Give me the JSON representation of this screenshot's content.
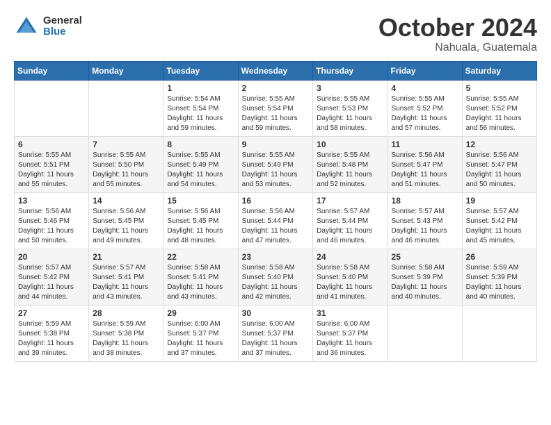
{
  "logo": {
    "general": "General",
    "blue": "Blue"
  },
  "title": "October 2024",
  "location": "Nahuala, Guatemala",
  "days_of_week": [
    "Sunday",
    "Monday",
    "Tuesday",
    "Wednesday",
    "Thursday",
    "Friday",
    "Saturday"
  ],
  "weeks": [
    [
      {
        "day": "",
        "content": ""
      },
      {
        "day": "",
        "content": ""
      },
      {
        "day": "1",
        "content": "Sunrise: 5:54 AM\nSunset: 5:54 PM\nDaylight: 11 hours and 59 minutes."
      },
      {
        "day": "2",
        "content": "Sunrise: 5:55 AM\nSunset: 5:54 PM\nDaylight: 11 hours and 59 minutes."
      },
      {
        "day": "3",
        "content": "Sunrise: 5:55 AM\nSunset: 5:53 PM\nDaylight: 11 hours and 58 minutes."
      },
      {
        "day": "4",
        "content": "Sunrise: 5:55 AM\nSunset: 5:52 PM\nDaylight: 11 hours and 57 minutes."
      },
      {
        "day": "5",
        "content": "Sunrise: 5:55 AM\nSunset: 5:52 PM\nDaylight: 11 hours and 56 minutes."
      }
    ],
    [
      {
        "day": "6",
        "content": "Sunrise: 5:55 AM\nSunset: 5:51 PM\nDaylight: 11 hours and 55 minutes."
      },
      {
        "day": "7",
        "content": "Sunrise: 5:55 AM\nSunset: 5:50 PM\nDaylight: 11 hours and 55 minutes."
      },
      {
        "day": "8",
        "content": "Sunrise: 5:55 AM\nSunset: 5:49 PM\nDaylight: 11 hours and 54 minutes."
      },
      {
        "day": "9",
        "content": "Sunrise: 5:55 AM\nSunset: 5:49 PM\nDaylight: 11 hours and 53 minutes."
      },
      {
        "day": "10",
        "content": "Sunrise: 5:55 AM\nSunset: 5:48 PM\nDaylight: 11 hours and 52 minutes."
      },
      {
        "day": "11",
        "content": "Sunrise: 5:56 AM\nSunset: 5:47 PM\nDaylight: 11 hours and 51 minutes."
      },
      {
        "day": "12",
        "content": "Sunrise: 5:56 AM\nSunset: 5:47 PM\nDaylight: 11 hours and 50 minutes."
      }
    ],
    [
      {
        "day": "13",
        "content": "Sunrise: 5:56 AM\nSunset: 5:46 PM\nDaylight: 11 hours and 50 minutes."
      },
      {
        "day": "14",
        "content": "Sunrise: 5:56 AM\nSunset: 5:45 PM\nDaylight: 11 hours and 49 minutes."
      },
      {
        "day": "15",
        "content": "Sunrise: 5:56 AM\nSunset: 5:45 PM\nDaylight: 11 hours and 48 minutes."
      },
      {
        "day": "16",
        "content": "Sunrise: 5:56 AM\nSunset: 5:44 PM\nDaylight: 11 hours and 47 minutes."
      },
      {
        "day": "17",
        "content": "Sunrise: 5:57 AM\nSunset: 5:44 PM\nDaylight: 11 hours and 46 minutes."
      },
      {
        "day": "18",
        "content": "Sunrise: 5:57 AM\nSunset: 5:43 PM\nDaylight: 11 hours and 46 minutes."
      },
      {
        "day": "19",
        "content": "Sunrise: 5:57 AM\nSunset: 5:42 PM\nDaylight: 11 hours and 45 minutes."
      }
    ],
    [
      {
        "day": "20",
        "content": "Sunrise: 5:57 AM\nSunset: 5:42 PM\nDaylight: 11 hours and 44 minutes."
      },
      {
        "day": "21",
        "content": "Sunrise: 5:57 AM\nSunset: 5:41 PM\nDaylight: 11 hours and 43 minutes."
      },
      {
        "day": "22",
        "content": "Sunrise: 5:58 AM\nSunset: 5:41 PM\nDaylight: 11 hours and 43 minutes."
      },
      {
        "day": "23",
        "content": "Sunrise: 5:58 AM\nSunset: 5:40 PM\nDaylight: 11 hours and 42 minutes."
      },
      {
        "day": "24",
        "content": "Sunrise: 5:58 AM\nSunset: 5:40 PM\nDaylight: 11 hours and 41 minutes."
      },
      {
        "day": "25",
        "content": "Sunrise: 5:58 AM\nSunset: 5:39 PM\nDaylight: 11 hours and 40 minutes."
      },
      {
        "day": "26",
        "content": "Sunrise: 5:59 AM\nSunset: 5:39 PM\nDaylight: 11 hours and 40 minutes."
      }
    ],
    [
      {
        "day": "27",
        "content": "Sunrise: 5:59 AM\nSunset: 5:38 PM\nDaylight: 11 hours and 39 minutes."
      },
      {
        "day": "28",
        "content": "Sunrise: 5:59 AM\nSunset: 5:38 PM\nDaylight: 11 hours and 38 minutes."
      },
      {
        "day": "29",
        "content": "Sunrise: 6:00 AM\nSunset: 5:37 PM\nDaylight: 11 hours and 37 minutes."
      },
      {
        "day": "30",
        "content": "Sunrise: 6:00 AM\nSunset: 5:37 PM\nDaylight: 11 hours and 37 minutes."
      },
      {
        "day": "31",
        "content": "Sunrise: 6:00 AM\nSunset: 5:37 PM\nDaylight: 11 hours and 36 minutes."
      },
      {
        "day": "",
        "content": ""
      },
      {
        "day": "",
        "content": ""
      }
    ]
  ]
}
